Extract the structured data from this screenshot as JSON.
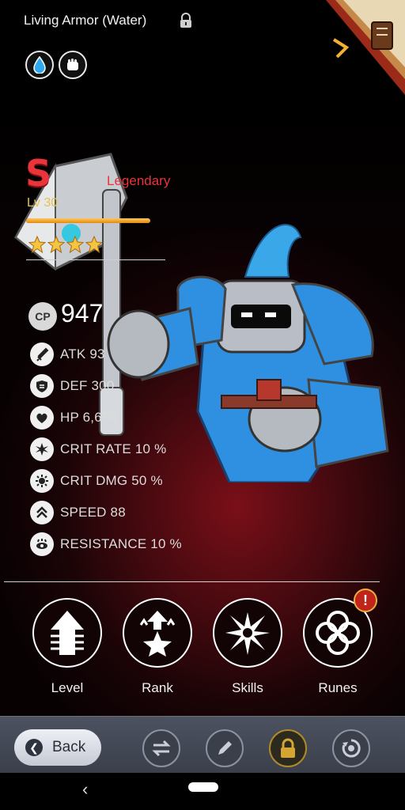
{
  "header": {
    "title": "Living Armor (Water)",
    "lock_icon": "padlock-icon",
    "type_icons": [
      "water-element-icon",
      "fist-attack-type-icon"
    ],
    "codex_icon": "book-icon"
  },
  "monster": {
    "grade": "S",
    "rarity": "Legendary",
    "level": "Lv 30",
    "xp_fraction": 1.0,
    "stars": 4,
    "cp_label": "CP",
    "cp_value": "947"
  },
  "stats": [
    {
      "icon": "sword-icon",
      "text": "ATK 93"
    },
    {
      "icon": "shield-icon",
      "text": "DEF 300"
    },
    {
      "icon": "heart-icon",
      "text": "HP 6,686"
    },
    {
      "icon": "crit-rate-burst-icon",
      "text": "CRIT RATE 10 %"
    },
    {
      "icon": "crit-damage-icon",
      "text": "CRIT DMG 50 %"
    },
    {
      "icon": "speed-chevrons-icon",
      "text": "SPEED 88"
    },
    {
      "icon": "resistance-eye-icon",
      "text": "RESISTANCE 10 %"
    }
  ],
  "actions": [
    {
      "label": "Level",
      "icon": "level-up-arrow-icon"
    },
    {
      "label": "Rank",
      "icon": "rank-star-icon"
    },
    {
      "label": "Skills",
      "icon": "skills-burst-icon"
    },
    {
      "label": "Runes",
      "icon": "runes-knot-icon"
    }
  ],
  "runes_alert": "!",
  "bottombar": {
    "back_label": "Back",
    "buttons": [
      "swap-icon",
      "pencil-icon",
      "lock-icon",
      "recycle-icon"
    ]
  },
  "colors": {
    "accent_red": "#e8343a",
    "level_gold": "#e6c24a",
    "background_red": "#7a0f18"
  }
}
